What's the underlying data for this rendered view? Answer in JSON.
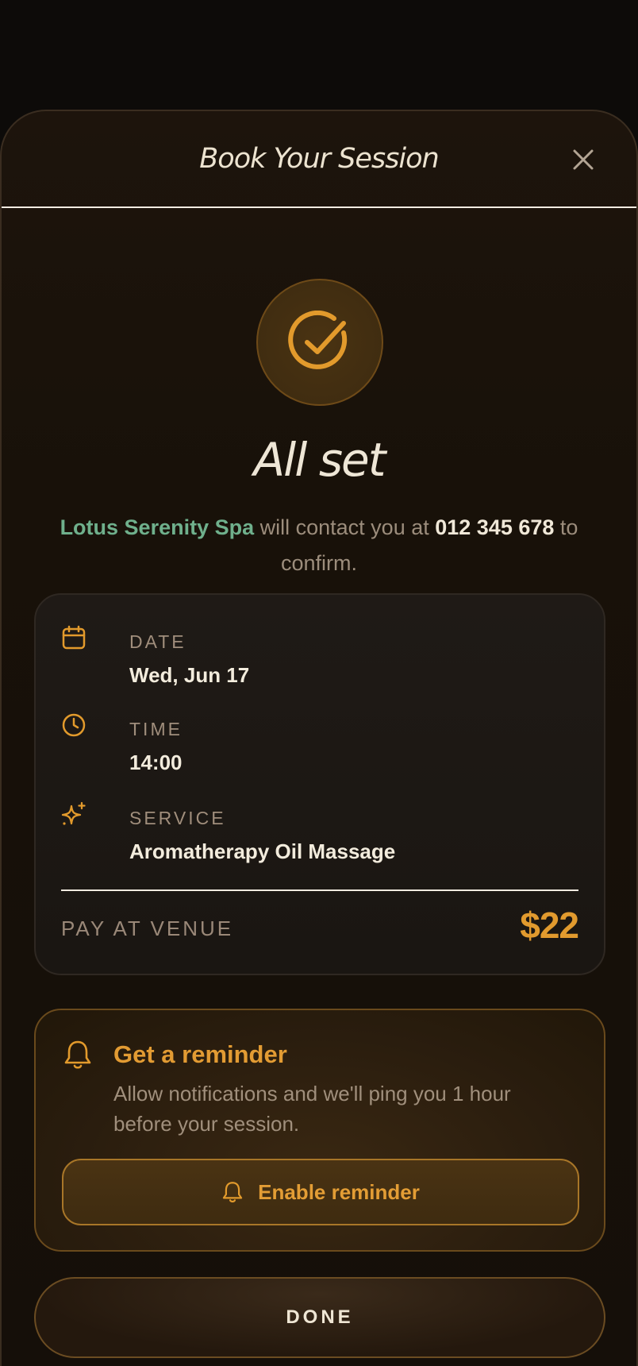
{
  "modal": {
    "title": "Book Your Session"
  },
  "confirmation": {
    "heading": "All set",
    "spa_name": "Lotus Serenity Spa",
    "text_middle": " will contact you at ",
    "phone": "012 345 678",
    "text_end": " to confirm."
  },
  "details": {
    "date": {
      "label": "DATE",
      "value": "Wed, Jun 17"
    },
    "time": {
      "label": "TIME",
      "value": "14:00"
    },
    "service": {
      "label": "SERVICE",
      "value": "Aromatherapy Oil Massage"
    },
    "pay_label": "PAY AT VENUE",
    "price": "$22"
  },
  "reminder": {
    "title": "Get a reminder",
    "description": "Allow notifications and we'll ping you 1 hour before your session.",
    "button_label": "Enable reminder"
  },
  "done_label": "DONE",
  "colors": {
    "accent": "#e19a2e",
    "spa_name": "#6fb08c",
    "background": "#150f09"
  },
  "icons": [
    "close-icon",
    "check-circle-icon",
    "calendar-icon",
    "clock-icon",
    "sparkle-icon",
    "bell-icon"
  ]
}
